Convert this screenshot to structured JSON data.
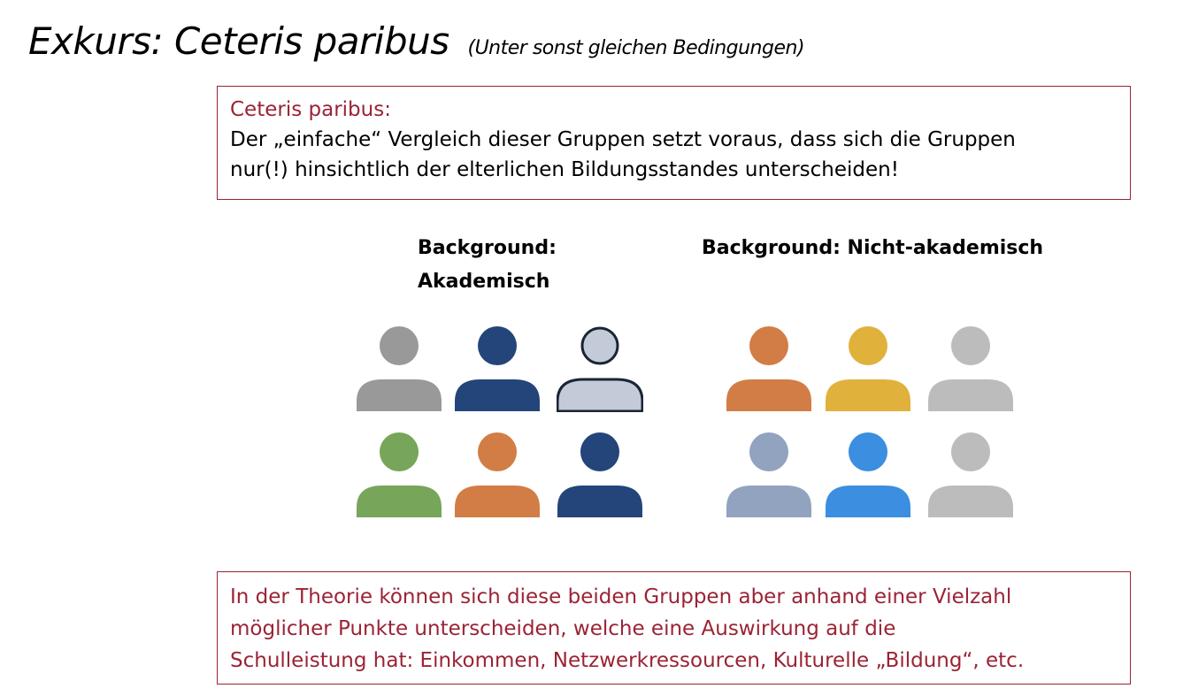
{
  "slide": {
    "title": "Exkurs: Ceteris paribus",
    "subtitle": "(Unter sonst gleichen Bedingungen)"
  },
  "top_box": {
    "heading": "Ceteris paribus:",
    "line1": "Der „einfache“ Vergleich dieser Gruppen setzt voraus, dass sich die Gruppen",
    "line2": "nur(!) hinsichtlich der elterlichen Bildungsstandes unterscheiden!"
  },
  "groups": {
    "left_label": "Background: Akademisch",
    "right_label": "Background: Nicht-akademisch"
  },
  "people": {
    "left": [
      {
        "color": "#999999",
        "style": "solid"
      },
      {
        "color": "#23457a",
        "style": "solid"
      },
      {
        "color": "#c3cad8",
        "style": "outlined"
      },
      {
        "color": "#77a55a",
        "style": "solid"
      },
      {
        "color": "#d27d45",
        "style": "solid"
      },
      {
        "color": "#23457a",
        "style": "solid"
      }
    ],
    "right": [
      {
        "color": "#d27d45",
        "style": "solid"
      },
      {
        "color": "#e0b23c",
        "style": "solid"
      },
      {
        "color": "#bcbcbc",
        "style": "solid"
      },
      {
        "color": "#91a3bf",
        "style": "solid"
      },
      {
        "color": "#3b8ee0",
        "style": "solid"
      },
      {
        "color": "#bcbcbc",
        "style": "solid"
      }
    ]
  },
  "bottom_box": {
    "line1": "In der Theorie können sich diese beiden Gruppen aber anhand einer Vielzahl",
    "line2": "möglicher Punkte unterscheiden, welche eine Auswirkung auf die",
    "line3": "Schulleistung hat: Einkommen, Netzwerkressourcen, Kulturelle „Bildung“, etc."
  },
  "accent_color": "#9b2335"
}
